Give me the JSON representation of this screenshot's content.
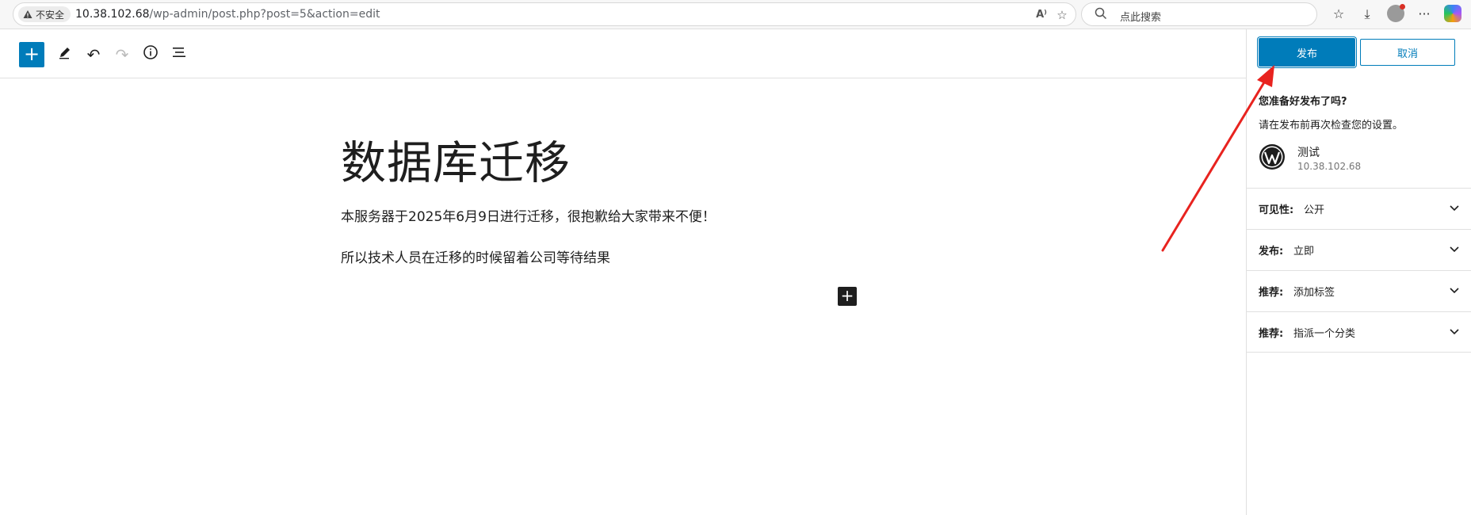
{
  "browser": {
    "security_label": "不安全",
    "url_host": "10.38.102.68",
    "url_path": "/wp-admin/post.php?post=5&action=edit",
    "search_placeholder": "点此搜索"
  },
  "editor": {
    "title": "数据库迁移",
    "paragraphs": [
      "本服务器于2025年6月9日进行迁移，很抱歉给大家带来不便！",
      "所以技术人员在迁移的时候留着公司等待结果"
    ]
  },
  "publish_panel": {
    "publish_label": "发布",
    "cancel_label": "取消",
    "ready_title": "您准备好发布了吗?",
    "ready_desc": "请在发布前再次检查您的设置。",
    "site_name": "测试",
    "site_url": "10.38.102.68",
    "rows": [
      {
        "label": "可见性:",
        "value": "公开"
      },
      {
        "label": "发布:",
        "value": "立即"
      },
      {
        "label": "推荐:",
        "value": "添加标签"
      },
      {
        "label": "推荐:",
        "value": "指派一个分类"
      }
    ]
  },
  "colors": {
    "accent": "#007cba",
    "annotation": "#e8231f"
  },
  "icons": [
    "warning-icon",
    "read-aloud-icon",
    "favorite-icon",
    "search-icon",
    "collections-icon",
    "downloads-icon",
    "more-icon",
    "plus-icon",
    "pencil-icon",
    "undo-icon",
    "redo-icon",
    "info-icon",
    "list-view-icon",
    "wordpress-logo",
    "chevron-down-icon"
  ]
}
